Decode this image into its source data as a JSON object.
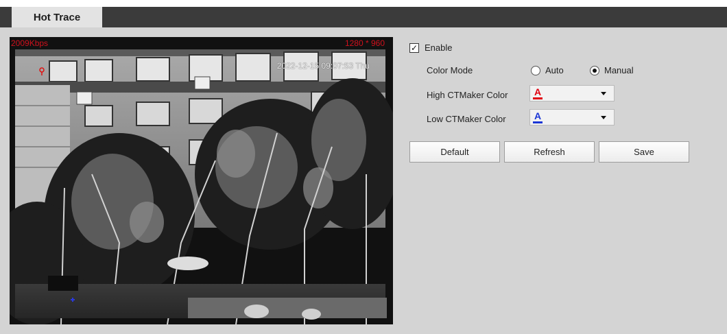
{
  "tab": {
    "label": "Hot Trace"
  },
  "video": {
    "bitrate": "2009Kbps",
    "resolution": "1280 * 960",
    "timestamp": "2022-12-15 09:07:53 Thu"
  },
  "settings": {
    "enable_label": "Enable",
    "enable_checked": true,
    "color_mode_label": "Color Mode",
    "color_mode_options": [
      "Auto",
      "Manual"
    ],
    "color_mode_selected": "Manual",
    "high_color_label": "High CTMaker Color",
    "high_color_value": "A",
    "high_color_hex": "#e0000f",
    "low_color_label": "Low CTMaker Color",
    "low_color_value": "A",
    "low_color_hex": "#1a35d6"
  },
  "buttons": {
    "default_label": "Default",
    "refresh_label": "Refresh",
    "save_label": "Save"
  }
}
